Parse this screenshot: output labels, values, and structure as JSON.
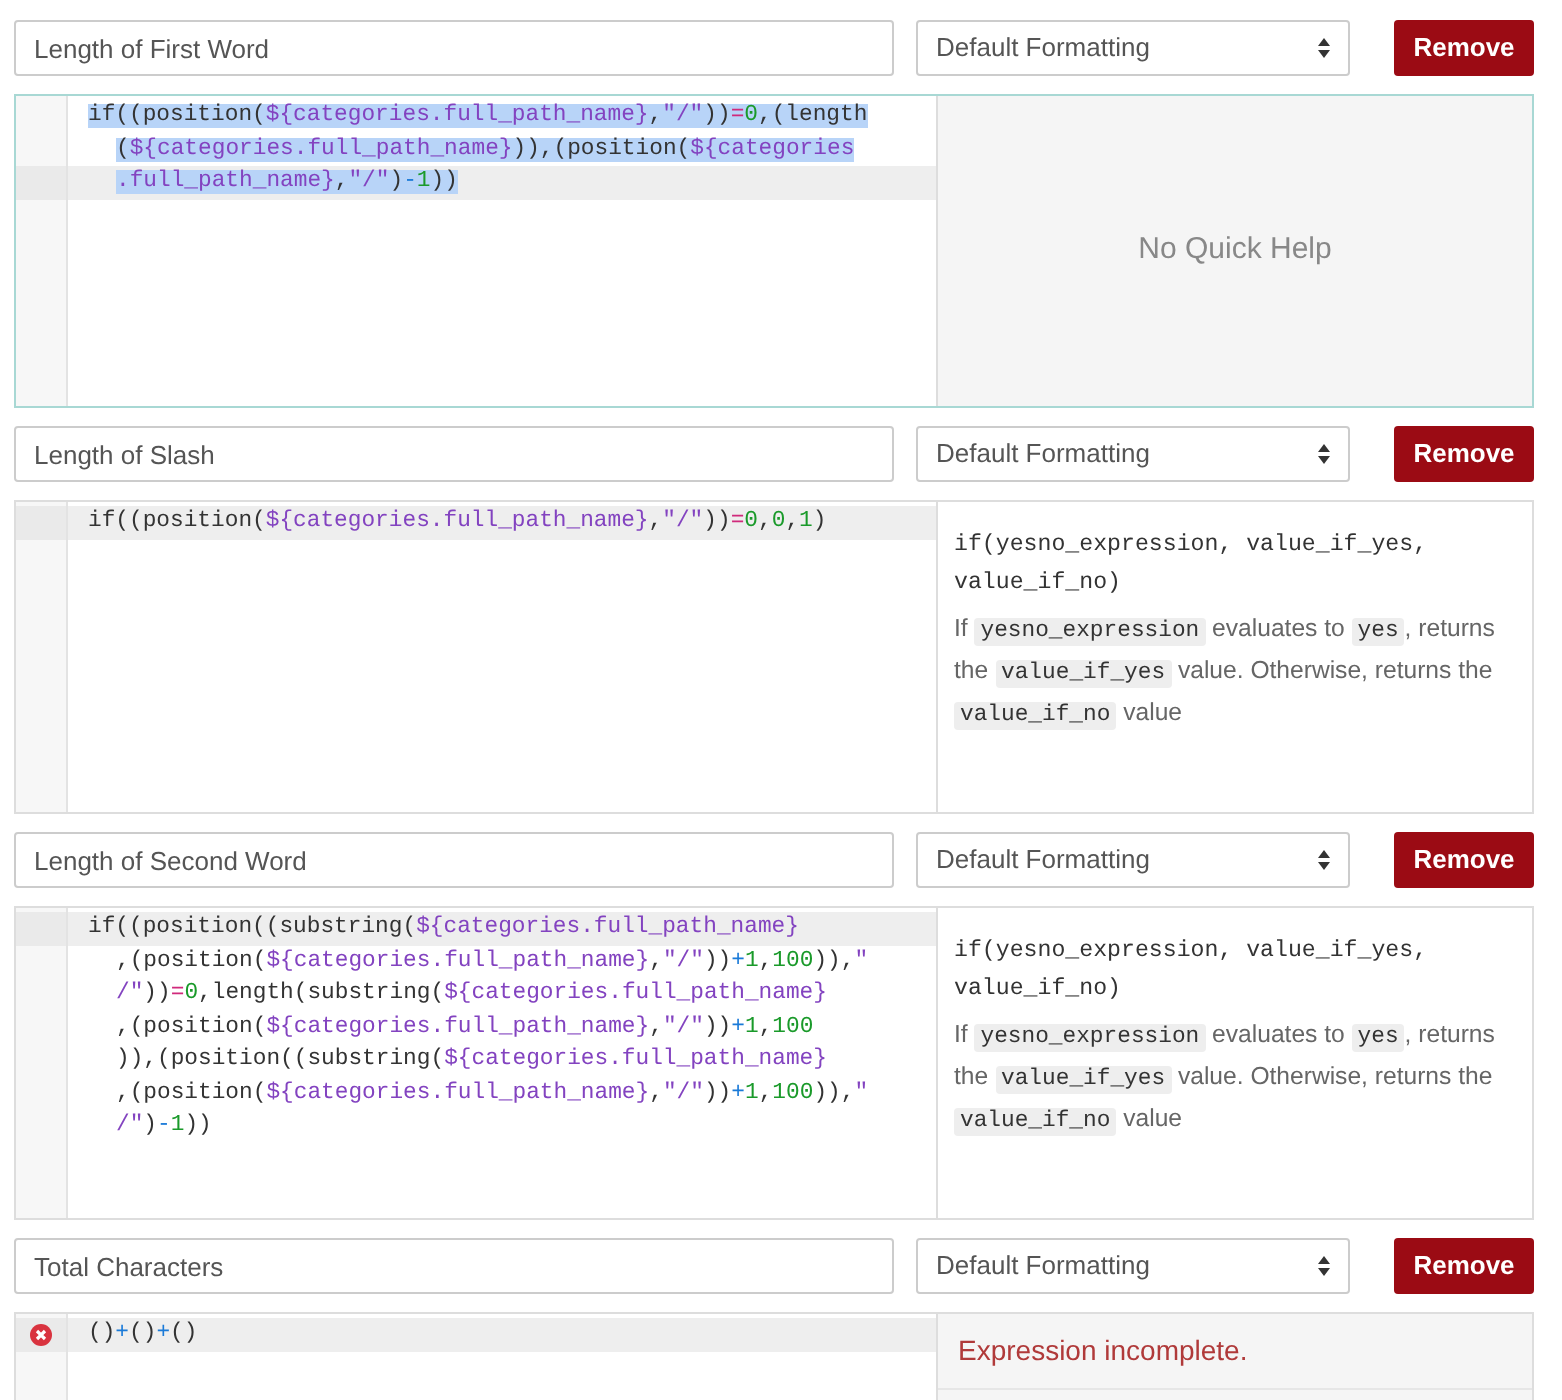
{
  "expressions": [
    {
      "name": "Length of First Word",
      "format": "Default Formatting",
      "remove_label": "Remove",
      "editor": {
        "focused": true,
        "selected": true,
        "lines": [
          {
            "active": false,
            "tokens": [
              {
                "kind": "plain",
                "text": "if((position("
              },
              {
                "kind": "var",
                "text": "${categories.full_path_name}"
              },
              {
                "kind": "plain",
                "text": ","
              },
              {
                "kind": "string",
                "text": "\"/\""
              },
              {
                "kind": "plain",
                "text": "))"
              },
              {
                "kind": "compare",
                "text": "="
              },
              {
                "kind": "number",
                "text": "0"
              },
              {
                "kind": "plain",
                "text": ",(length"
              }
            ]
          },
          {
            "active": false,
            "wrapped": true,
            "tokens": [
              {
                "kind": "plain",
                "text": "("
              },
              {
                "kind": "var",
                "text": "${categories.full_path_name}"
              },
              {
                "kind": "plain",
                "text": ")),(position("
              },
              {
                "kind": "var",
                "text": "${categories"
              }
            ]
          },
          {
            "active": true,
            "wrapped": true,
            "tokens": [
              {
                "kind": "var",
                "text": ".full_path_name}"
              },
              {
                "kind": "plain",
                "text": ","
              },
              {
                "kind": "string",
                "text": "\"/\""
              },
              {
                "kind": "plain",
                "text": ")"
              },
              {
                "kind": "arith",
                "text": "-"
              },
              {
                "kind": "number",
                "text": "1"
              },
              {
                "kind": "plain",
                "text": "))"
              }
            ]
          }
        ]
      },
      "help": {
        "kind": "none",
        "text": "No Quick Help"
      }
    },
    {
      "name": "Length of Slash",
      "format": "Default Formatting",
      "remove_label": "Remove",
      "editor": {
        "focused": false,
        "selected": false,
        "lines": [
          {
            "active": true,
            "tokens": [
              {
                "kind": "plain",
                "text": "if((position("
              },
              {
                "kind": "var",
                "text": "${categories.full_path_name}"
              },
              {
                "kind": "plain",
                "text": ","
              },
              {
                "kind": "string",
                "text": "\"/\""
              },
              {
                "kind": "plain",
                "text": "))"
              },
              {
                "kind": "compare",
                "text": "="
              },
              {
                "kind": "number",
                "text": "0"
              },
              {
                "kind": "plain",
                "text": ","
              },
              {
                "kind": "number",
                "text": "0"
              },
              {
                "kind": "plain",
                "text": ","
              },
              {
                "kind": "number",
                "text": "1"
              },
              {
                "kind": "plain",
                "text": ")"
              }
            ]
          }
        ]
      },
      "help": {
        "kind": "doc",
        "signature": "if(yesno_expression, value_if_yes, value_if_no)",
        "description": [
          {
            "text": "If ",
            "code": false
          },
          {
            "text": "yesno_expression",
            "code": true
          },
          {
            "text": " evaluates to ",
            "code": false
          },
          {
            "text": "yes",
            "code": true
          },
          {
            "text": ", returns the ",
            "code": false
          },
          {
            "text": "value_if_yes",
            "code": true
          },
          {
            "text": " value. Otherwise, returns the ",
            "code": false
          },
          {
            "text": "value_if_no",
            "code": true
          },
          {
            "text": " value",
            "code": false
          }
        ]
      }
    },
    {
      "name": "Length of Second Word",
      "format": "Default Formatting",
      "remove_label": "Remove",
      "editor": {
        "focused": false,
        "selected": false,
        "lines": [
          {
            "active": true,
            "tokens": [
              {
                "kind": "plain",
                "text": "if((position((substring("
              },
              {
                "kind": "var",
                "text": "${categories.full_path_name}"
              }
            ]
          },
          {
            "active": false,
            "wrapped": true,
            "tokens": [
              {
                "kind": "plain",
                "text": ",(position("
              },
              {
                "kind": "var",
                "text": "${categories.full_path_name}"
              },
              {
                "kind": "plain",
                "text": ","
              },
              {
                "kind": "string",
                "text": "\"/\""
              },
              {
                "kind": "plain",
                "text": "))"
              },
              {
                "kind": "arith",
                "text": "+"
              },
              {
                "kind": "number",
                "text": "1"
              },
              {
                "kind": "plain",
                "text": ","
              },
              {
                "kind": "number",
                "text": "100"
              },
              {
                "kind": "plain",
                "text": ")),"
              },
              {
                "kind": "string",
                "text": "\""
              }
            ]
          },
          {
            "active": false,
            "wrapped": true,
            "tokens": [
              {
                "kind": "string",
                "text": "/\""
              },
              {
                "kind": "plain",
                "text": "))"
              },
              {
                "kind": "compare",
                "text": "="
              },
              {
                "kind": "number",
                "text": "0"
              },
              {
                "kind": "plain",
                "text": ",length(substring("
              },
              {
                "kind": "var",
                "text": "${categories.full_path_name}"
              }
            ]
          },
          {
            "active": false,
            "wrapped": true,
            "tokens": [
              {
                "kind": "plain",
                "text": ",(position("
              },
              {
                "kind": "var",
                "text": "${categories.full_path_name}"
              },
              {
                "kind": "plain",
                "text": ","
              },
              {
                "kind": "string",
                "text": "\"/\""
              },
              {
                "kind": "plain",
                "text": "))"
              },
              {
                "kind": "arith",
                "text": "+"
              },
              {
                "kind": "number",
                "text": "1"
              },
              {
                "kind": "plain",
                "text": ","
              },
              {
                "kind": "number",
                "text": "100"
              }
            ]
          },
          {
            "active": false,
            "wrapped": true,
            "tokens": [
              {
                "kind": "plain",
                "text": ")),(position((substring("
              },
              {
                "kind": "var",
                "text": "${categories.full_path_name}"
              }
            ]
          },
          {
            "active": false,
            "wrapped": true,
            "tokens": [
              {
                "kind": "plain",
                "text": ",(position("
              },
              {
                "kind": "var",
                "text": "${categories.full_path_name}"
              },
              {
                "kind": "plain",
                "text": ","
              },
              {
                "kind": "string",
                "text": "\"/\""
              },
              {
                "kind": "plain",
                "text": "))"
              },
              {
                "kind": "arith",
                "text": "+"
              },
              {
                "kind": "number",
                "text": "1"
              },
              {
                "kind": "plain",
                "text": ","
              },
              {
                "kind": "number",
                "text": "100"
              },
              {
                "kind": "plain",
                "text": ")),"
              },
              {
                "kind": "string",
                "text": "\""
              }
            ]
          },
          {
            "active": false,
            "wrapped": true,
            "tokens": [
              {
                "kind": "string",
                "text": "/\""
              },
              {
                "kind": "plain",
                "text": ")"
              },
              {
                "kind": "arith",
                "text": "-"
              },
              {
                "kind": "number",
                "text": "1"
              },
              {
                "kind": "plain",
                "text": "))"
              }
            ]
          }
        ]
      },
      "help": {
        "kind": "doc",
        "signature": "if(yesno_expression, value_if_yes, value_if_no)",
        "description": [
          {
            "text": "If ",
            "code": false
          },
          {
            "text": "yesno_expression",
            "code": true
          },
          {
            "text": " evaluates to ",
            "code": false
          },
          {
            "text": "yes",
            "code": true
          },
          {
            "text": ", returns the ",
            "code": false
          },
          {
            "text": "value_if_yes",
            "code": true
          },
          {
            "text": " value. Otherwise, returns the ",
            "code": false
          },
          {
            "text": "value_if_no",
            "code": true
          },
          {
            "text": " value",
            "code": false
          }
        ]
      }
    },
    {
      "name": "Total Characters",
      "format": "Default Formatting",
      "remove_label": "Remove",
      "editor": {
        "focused": false,
        "selected": false,
        "lines": [
          {
            "active": true,
            "error": true,
            "tokens": [
              {
                "kind": "plain",
                "text": "()"
              },
              {
                "kind": "arith",
                "text": "+"
              },
              {
                "kind": "plain",
                "text": "()"
              },
              {
                "kind": "arith",
                "text": "+"
              },
              {
                "kind": "plain",
                "text": "()"
              }
            ]
          }
        ]
      },
      "help": {
        "kind": "error",
        "text": "Expression incomplete."
      }
    }
  ]
}
